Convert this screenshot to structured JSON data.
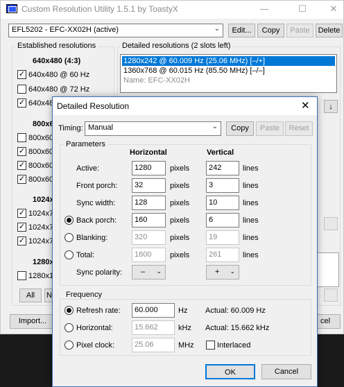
{
  "main": {
    "title": "Custom Resolution Utility 1.5.1 by ToastyX",
    "monitor_value": "EFL5202 - EFC-XX02H (active)",
    "buttons": {
      "edit": "Edit...",
      "copy": "Copy",
      "paste": "Paste",
      "delete": "Delete"
    },
    "established_label": "Established resolutions",
    "detailed_label": "Detailed resolutions (2 slots left)",
    "detailed_list": [
      "1280x242 @ 60.009 Hz (25.06 MHz) [–/+]",
      "1360x768 @ 60.015 Hz (85.50 MHz) [–/–]",
      "Name: EFC-XX02H"
    ],
    "est_groups": [
      {
        "header": "640x480 (4:3)",
        "items": [
          "640x480 @ 60 Hz",
          "640x480 @ 72 Hz",
          "640x48"
        ]
      },
      {
        "header": "800x60",
        "items": [
          "800x60",
          "800x60",
          "800x60",
          "800x60"
        ]
      },
      {
        "header": "1024x7",
        "items": [
          "1024x7",
          "1024x7",
          "1024x7"
        ]
      },
      {
        "header": "1280x",
        "items": [
          "1280x10"
        ]
      }
    ],
    "all_label": "All",
    "n_label": "N",
    "import_label": "Import...",
    "cancel_partial": "cel",
    "down_arrow": "↓"
  },
  "dialog": {
    "title": "Detailed Resolution",
    "timing_label": "Timing:",
    "timing_value": "Manual",
    "copy": "Copy",
    "paste": "Paste",
    "reset": "Reset",
    "parameters_label": "Parameters",
    "horizontal_header": "Horizontal",
    "vertical_header": "Vertical",
    "rows": [
      {
        "label": "Active:",
        "h": "1280",
        "h_unit": "pixels",
        "v": "242",
        "v_unit": "lines"
      },
      {
        "label": "Front porch:",
        "h": "32",
        "h_unit": "pixels",
        "v": "3",
        "v_unit": "lines"
      },
      {
        "label": "Sync width:",
        "h": "128",
        "h_unit": "pixels",
        "v": "10",
        "v_unit": "lines"
      },
      {
        "label": "Back porch:",
        "h": "160",
        "h_unit": "pixels",
        "v": "6",
        "v_unit": "lines"
      },
      {
        "label": "Blanking:",
        "h": "320",
        "h_unit": "pixels",
        "v": "19",
        "v_unit": "lines"
      },
      {
        "label": "Total:",
        "h": "1600",
        "h_unit": "pixels",
        "v": "261",
        "v_unit": "lines"
      }
    ],
    "sync_polarity_label": "Sync polarity:",
    "sync_h": "–",
    "sync_v": "+",
    "frequency_label": "Frequency",
    "refresh_label": "Refresh rate:",
    "refresh_value": "60.000",
    "refresh_unit": "Hz",
    "refresh_actual": "Actual: 60.009 Hz",
    "horizontal_label": "Horizontal:",
    "horizontal_value": "15.662",
    "horizontal_unit": "kHz",
    "horizontal_actual": "Actual: 15.662 kHz",
    "pixelclock_label": "Pixel clock:",
    "pixelclock_value": "25.06",
    "pixelclock_unit": "MHz",
    "interlaced_label": "Interlaced",
    "ok": "OK",
    "cancel": "Cancel"
  },
  "colors": {
    "selection": "#0078d7",
    "dialog_border": "#3c6eb4"
  }
}
